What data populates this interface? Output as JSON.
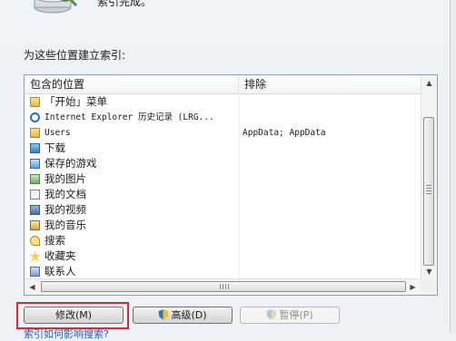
{
  "status_text": "索引完成。",
  "section_label": "为这些位置建立索引:",
  "columns": {
    "included": "包含的位置",
    "exclude": "排除"
  },
  "rows": [
    {
      "name": "「开始」菜单",
      "exclude": "",
      "icon": "folder-icon"
    },
    {
      "name": "Internet Explorer 历史记录 (LRG...",
      "exclude": "",
      "icon": "internet-explorer-icon"
    },
    {
      "name": "Users",
      "exclude": "AppData; AppData",
      "icon": "folder-icon"
    },
    {
      "name": "下载",
      "exclude": "",
      "icon": "download-folder-icon"
    },
    {
      "name": "保存的游戏",
      "exclude": "",
      "icon": "saved-games-icon"
    },
    {
      "name": "我的图片",
      "exclude": "",
      "icon": "pictures-library-icon"
    },
    {
      "name": "我的文档",
      "exclude": "",
      "icon": "documents-library-icon"
    },
    {
      "name": "我的视频",
      "exclude": "",
      "icon": "videos-library-icon"
    },
    {
      "name": "我的音乐",
      "exclude": "",
      "icon": "music-library-icon"
    },
    {
      "name": "搜索",
      "exclude": "",
      "icon": "searches-folder-icon"
    },
    {
      "name": "收藏夹",
      "exclude": "",
      "icon": "favorites-folder-icon"
    },
    {
      "name": "联系人",
      "exclude": "",
      "icon": "contacts-folder-icon"
    }
  ],
  "buttons": {
    "modify": "修改(M)",
    "advanced": "高级(D)",
    "pause": "暂停(P)"
  },
  "hscroll_grip": "III",
  "bottom_link": "索引如何影响搜索?",
  "colors": {
    "highlight_border": "#d92b2b",
    "link": "#1a5fb4"
  }
}
